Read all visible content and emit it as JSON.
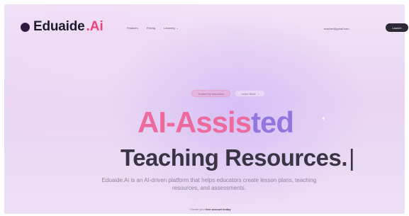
{
  "brand": {
    "name": "Eduaide",
    "accent": ".Ai",
    "accent_color": "#f0437a",
    "mark_icon": "circle-logo-icon"
  },
  "nav": {
    "links": [
      {
        "label": "Features"
      },
      {
        "label": "Pricing"
      },
      {
        "label": "Learning",
        "icon": "chevron-down-icon"
      }
    ],
    "user_email": "teacher@gmail.com",
    "button_label": "Launch"
  },
  "hero": {
    "pill_primary": "Trusted by educators",
    "pill_secondary": "Learn More",
    "headline_line1_part1": "AI-Assis",
    "headline_line1_part2": "ted",
    "headline_line2": "Teaching Resources.",
    "cursor": "|",
    "subtext": "Eduaide.Ai is an AI-driven platform that helps educators create lesson plans, teaching resources, and assessments.",
    "cta_prefix": "Create your",
    "cta_link": "free account today"
  },
  "colors": {
    "headline_pink": "#ec6a9c",
    "headline_purple": "#8f77dd",
    "headline_dark": "#3a3544",
    "button_bg": "#2d2a36"
  }
}
